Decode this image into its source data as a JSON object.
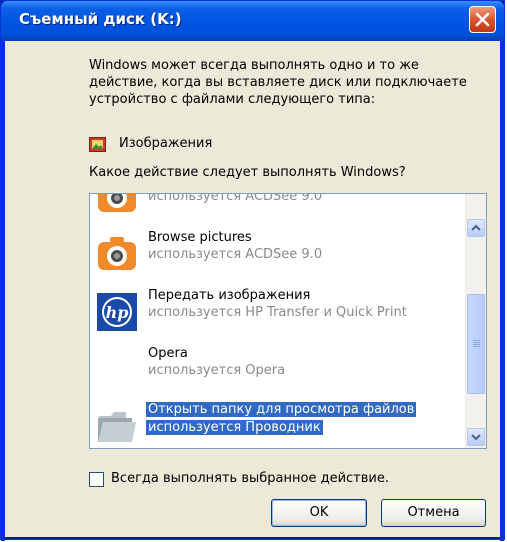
{
  "window": {
    "title": "Съемный диск (K:)"
  },
  "description": "Windows может всегда выполнять одно и то же действие, когда вы вставляете диск или подключаете устройство с файлами следующего типа:",
  "content_type": {
    "icon": "picture-icon",
    "label": "Изображения"
  },
  "question": "Какое действие следует выполнять Windows?",
  "actions": [
    {
      "name": "",
      "sub": "используется ACDSee 9.0",
      "icon": "camera-icon",
      "selected": false
    },
    {
      "name": "Browse pictures",
      "sub": "используется ACDSee 9.0",
      "icon": "camera-icon",
      "selected": false
    },
    {
      "name": "Передать изображения",
      "sub": "используется HP Transfer и Quick Print",
      "icon": "hp-logo-icon",
      "selected": false
    },
    {
      "name": "Opera",
      "sub": "используется Opera",
      "icon": "",
      "selected": false
    },
    {
      "name": "Открыть папку для просмотра файлов",
      "sub": "используется Проводник",
      "icon": "folder-icon",
      "selected": true
    }
  ],
  "always_checkbox": {
    "label": "Всегда выполнять выбранное действие.",
    "checked": false
  },
  "buttons": {
    "ok": "OK",
    "cancel": "Отмена"
  },
  "colors": {
    "titlebar": "#0054e3",
    "client": "#ece9d8",
    "selection": "#316ac5",
    "close": "#d9502a"
  }
}
